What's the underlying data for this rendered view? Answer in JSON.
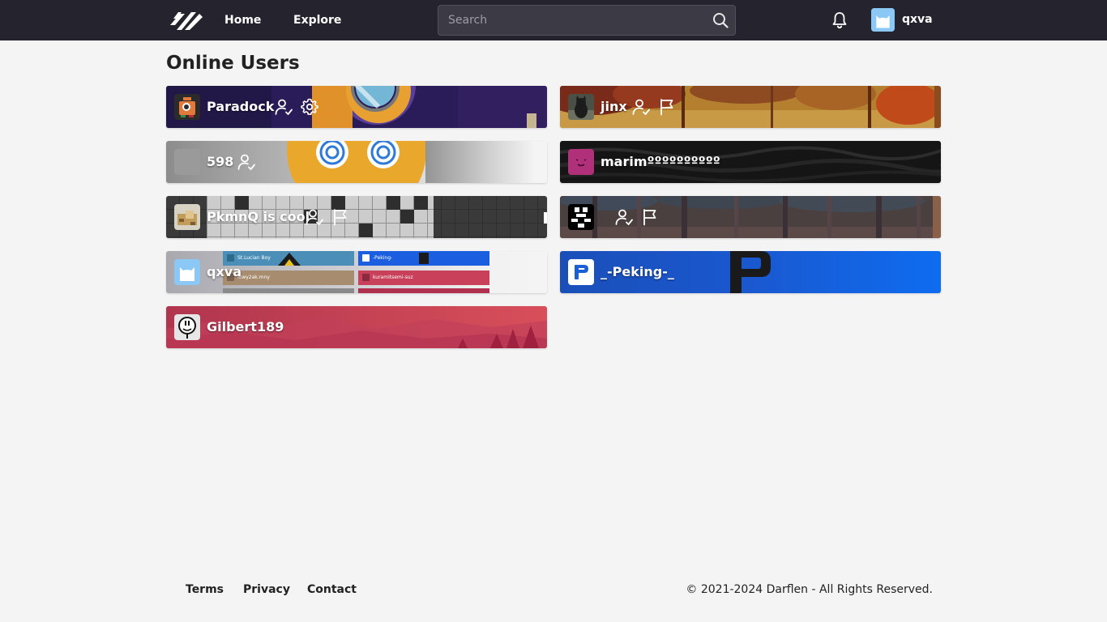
{
  "nav": {
    "home_label": "Home",
    "explore_label": "Explore",
    "search_placeholder": "Search",
    "current_user": "qxva"
  },
  "page_title": "Online Users",
  "users": [
    {
      "name": "Paradock"
    },
    {
      "name": "jinx"
    },
    {
      "name": "598"
    },
    {
      "name": "marimºººººººººº"
    },
    {
      "name": "PkmnQ is cool"
    },
    {
      "name": ""
    },
    {
      "name": "qxva"
    },
    {
      "name": "_-Peking-_"
    },
    {
      "name": "Gilbert189"
    }
  ],
  "qxva_banner_preview": {
    "item1": "St.Lucian Boy",
    "item2": "-Peking-",
    "item3": "lowy2ak.mny",
    "item4": "kuramitsemi-suz"
  },
  "footer": {
    "terms": "Terms",
    "privacy": "Privacy",
    "contact": "Contact",
    "copyright": "© 2021-2024 Darflen - All Rights Reserved."
  },
  "colors": {
    "navbar": "#25242e",
    "page_background": "#f4f4f4",
    "peking_blue": "#1060e0"
  }
}
